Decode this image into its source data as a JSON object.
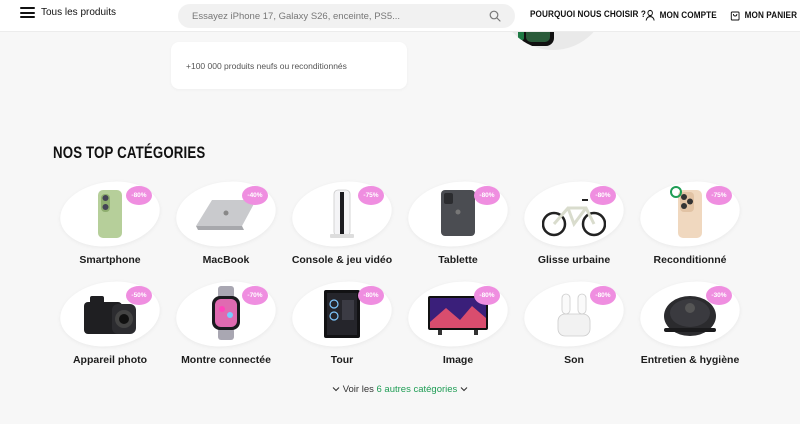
{
  "header": {
    "menu_label": "Tous les produits",
    "search_placeholder": "Essayez iPhone 17, Galaxy S26, enceinte, PS5...",
    "nav_why": "POURQUOI NOUS CHOISIR ?",
    "nav_account": "MON COMPTE",
    "nav_cart": "MON PANIER"
  },
  "promo": {
    "text": "+100 000 produits neufs ou reconditionnés"
  },
  "section": {
    "title": "NOS TOP CATÉGORIES",
    "categories": [
      {
        "label": "Smartphone",
        "discount": "-80%",
        "icon": "phone"
      },
      {
        "label": "MacBook",
        "discount": "-40%",
        "icon": "laptop"
      },
      {
        "label": "Console & jeu vidéo",
        "discount": "-75%",
        "icon": "console"
      },
      {
        "label": "Tablette",
        "discount": "-80%",
        "icon": "tablet"
      },
      {
        "label": "Glisse urbaine",
        "discount": "-80%",
        "icon": "bike"
      },
      {
        "label": "Reconditionné",
        "discount": "-75%",
        "icon": "phone-refurb"
      },
      {
        "label": "Appareil photo",
        "discount": "-50%",
        "icon": "camera"
      },
      {
        "label": "Montre connectée",
        "discount": "-70%",
        "icon": "watch"
      },
      {
        "label": "Tour",
        "discount": "-80%",
        "icon": "pc-tower"
      },
      {
        "label": "Image",
        "discount": "-80%",
        "icon": "tv"
      },
      {
        "label": "Son",
        "discount": "-80%",
        "icon": "earbuds"
      },
      {
        "label": "Entretien & hygiène",
        "discount": "-30%",
        "icon": "robot-vacuum"
      }
    ],
    "more_prefix": "Voir les",
    "more_count": "6 autres catégories"
  },
  "colors": {
    "badge": "#ef8ee0",
    "link_green": "#1f9d55",
    "background": "#f7f7f7"
  }
}
